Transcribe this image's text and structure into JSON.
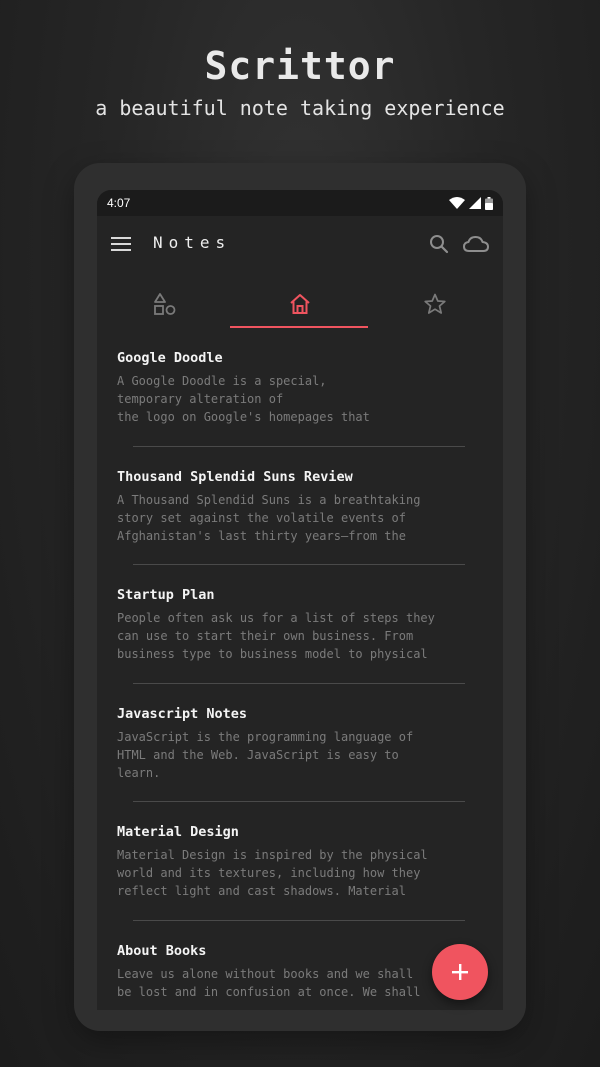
{
  "promo": {
    "title": "Scrittor",
    "subtitle": "a beautiful note taking experience"
  },
  "status_bar": {
    "time": "4:07",
    "icons": [
      "wifi-icon",
      "signal-icon",
      "battery-icon"
    ]
  },
  "app_bar": {
    "title": "Notes",
    "icons": [
      "menu-icon",
      "search-icon",
      "cloud-icon"
    ]
  },
  "tabs": [
    {
      "icon": "shapes-icon",
      "selected": false
    },
    {
      "icon": "home-icon",
      "selected": true
    },
    {
      "icon": "star-icon",
      "selected": false
    }
  ],
  "notes": [
    {
      "title": "Google Doodle",
      "preview": "A Google Doodle is a special,\ntemporary alteration of\nthe logo on Google's homepages that"
    },
    {
      "title": "Thousand Splendid Suns Review",
      "preview": "A Thousand Splendid Suns is a breathtaking\nstory set against the volatile events of\nAfghanistan's last thirty years—from the"
    },
    {
      "title": "Startup Plan",
      "preview": "People often ask us for a list of steps they\ncan use to start their own business. From\nbusiness type to business model to physical"
    },
    {
      "title": "Javascript Notes",
      "preview": "JavaScript is the programming language of\nHTML and the Web. JavaScript is easy to\nlearn."
    },
    {
      "title": "Material Design",
      "preview": "Material Design is inspired by the physical\nworld and its textures, including how they\nreflect light and cast shadows. Material"
    },
    {
      "title": "About Books",
      "preview": "Leave us alone without books and we shall\nbe lost and in confusion at once. We shall"
    }
  ],
  "fab": {
    "icon": "plus-icon"
  },
  "colors": {
    "accent": "#f0545f",
    "background": "#242424",
    "text_primary": "#f4f4f4",
    "text_secondary": "#7b7b7b"
  }
}
